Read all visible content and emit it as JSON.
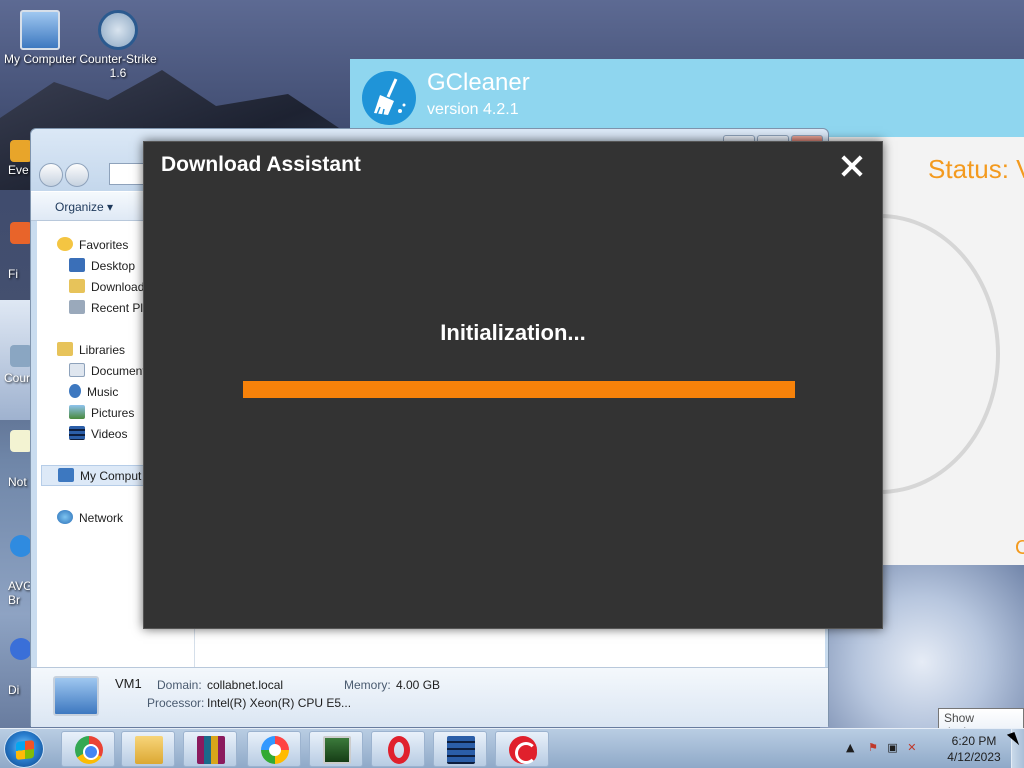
{
  "desktop": {
    "icons": [
      {
        "label": "My Computer"
      },
      {
        "label": "Counter-Strike 1.6"
      }
    ],
    "partial_labels": [
      "Eve",
      "Fi",
      "Cour",
      "Not",
      "AVG Br",
      "Di"
    ]
  },
  "gcleaner": {
    "title": "GCleaner",
    "version": "version 4.2.1",
    "status": "Status: V",
    "corner_text": "C"
  },
  "explorer": {
    "organize": "Organize ▾",
    "nav": {
      "favorites": "Favorites",
      "desktop": "Desktop",
      "downloads": "Download",
      "recent": "Recent Pla",
      "libraries": "Libraries",
      "documents": "Document",
      "music": "Music",
      "pictures": "Pictures",
      "videos": "Videos",
      "my_computer": "My Comput",
      "network": "Network"
    },
    "details": {
      "name": "VM1",
      "domain_label": "Domain:",
      "domain_value": "collabnet.local",
      "memory_label": "Memory:",
      "memory_value": "4.00 GB",
      "processor_label": "Processor:",
      "processor_value": "Intel(R) Xeon(R) CPU E5..."
    }
  },
  "dialog": {
    "title": "Download Assistant",
    "message": "Initialization...",
    "progress": 1.0,
    "bar_color": "#f7820a",
    "close_icon": "close-icon"
  },
  "taskbar": {
    "apps": [
      "chrome",
      "file-explorer",
      "winrar",
      "ring-app",
      "monitor-app",
      "opera",
      "video-app",
      "ccleaner"
    ],
    "time": "6:20 PM",
    "date": "4/12/2023",
    "show_desktop_tooltip": "Show desktop"
  }
}
